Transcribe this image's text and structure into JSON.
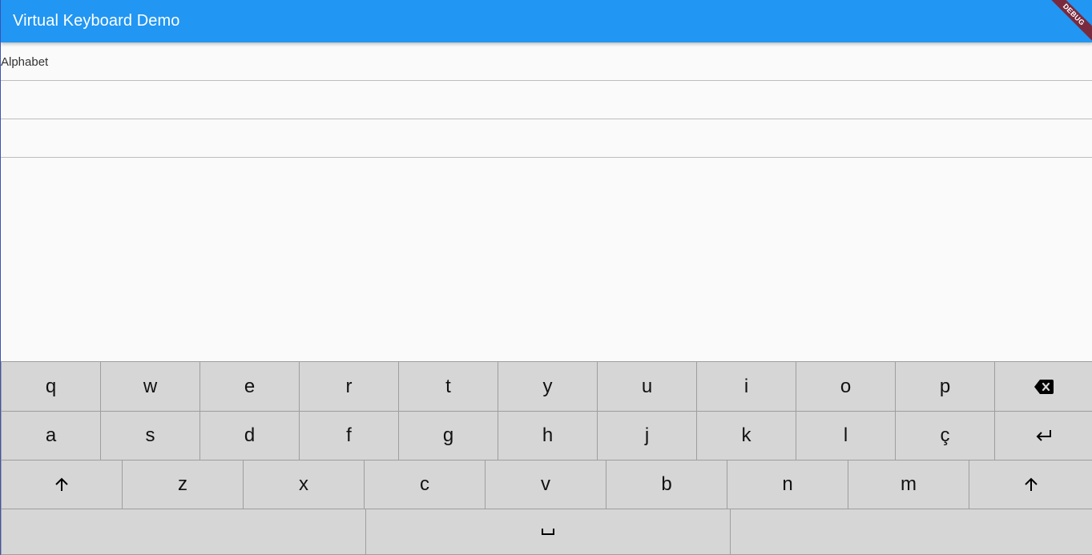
{
  "appbar": {
    "title": "Virtual Keyboard Demo",
    "debug_badge": "DEBUG"
  },
  "fields": [
    {
      "label": "Alphabet",
      "value": ""
    },
    {
      "label": "",
      "value": ""
    },
    {
      "label": "",
      "value": ""
    }
  ],
  "keyboard": {
    "row1": [
      "q",
      "w",
      "e",
      "r",
      "t",
      "y",
      "u",
      "i",
      "o",
      "p"
    ],
    "row1_end_icon": "backspace-icon",
    "row2": [
      "a",
      "s",
      "d",
      "f",
      "g",
      "h",
      "j",
      "k",
      "l",
      "ç"
    ],
    "row2_end_icon": "return-icon",
    "row3_start_icon": "shift-icon",
    "row3": [
      "z",
      "x",
      "c",
      "v",
      "b",
      "n",
      "m"
    ],
    "row3_end_icon": "shift-icon",
    "row4_center_icon": "space-icon"
  }
}
